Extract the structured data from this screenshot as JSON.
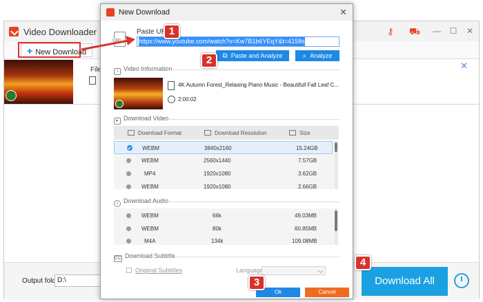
{
  "main": {
    "title": "Video Downloader",
    "new_download_label": "New Download",
    "output_folder_label": "Output folder:",
    "output_folder_value": "D:\\",
    "download_all_label": "Download All",
    "task_file_label": "File N"
  },
  "dialog": {
    "title": "New Download",
    "paste_url_label": "Paste URL",
    "url_icon_text": "URL",
    "url_value": "https://www.youtube.com/watch?v=Kw7B1b6YEqY&t=4158s",
    "paste_analyze_label": "Paste and Analyze",
    "analyze_label": "Analyze",
    "video_info": {
      "section_title": "Video Information",
      "name": "4K Autumn Forest_Relaxing Piano Music - Beautifull Fall Leaf C...",
      "duration": "2:00:02"
    },
    "download_video": {
      "section_title": "Download Video",
      "headers": {
        "format": "Download Format",
        "resolution": "Download Resolution",
        "size": "Size"
      },
      "rows": [
        {
          "format": "WEBM",
          "resolution": "3840x2160",
          "size": "15.24GB",
          "selected": true
        },
        {
          "format": "WEBM",
          "resolution": "2560x1440",
          "size": "7.57GB",
          "selected": false
        },
        {
          "format": "MP4",
          "resolution": "1920x1080",
          "size": "3.62GB",
          "selected": false
        },
        {
          "format": "WEBM",
          "resolution": "1920x1080",
          "size": "2.66GB",
          "selected": false
        }
      ]
    },
    "download_audio": {
      "section_title": "Download Audio",
      "rows": [
        {
          "format": "WEBM",
          "bitrate": "66k",
          "size": "49.03MB"
        },
        {
          "format": "WEBM",
          "bitrate": "80k",
          "size": "60.85MB"
        },
        {
          "format": "M4A",
          "bitrate": "134k",
          "size": "109.08MB"
        }
      ]
    },
    "download_subtitle": {
      "section_title": "Download Subtitle",
      "original_label": "Original Subtitles",
      "language_label": "Language"
    },
    "ok_label": "Ok",
    "cancel_label": "Cancel"
  },
  "badges": [
    "1",
    "2",
    "3",
    "4"
  ],
  "colors": {
    "accent_blue": "#1e88e5",
    "download_all_blue": "#1ba1e2",
    "cancel_orange": "#f06a22",
    "annotation_red": "#d9322b",
    "brand_red": "#e8421e"
  }
}
